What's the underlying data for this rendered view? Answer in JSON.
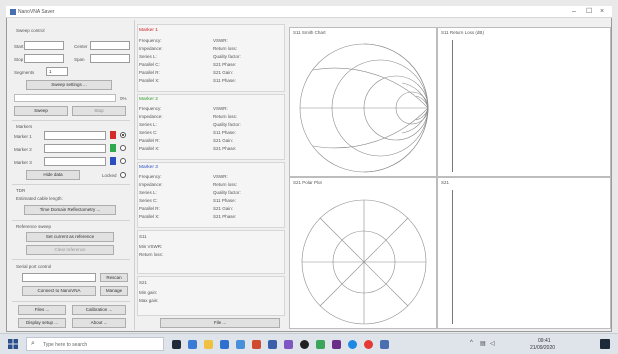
{
  "window": {
    "title": "NanoVNA Saver"
  },
  "sweep": {
    "header": "Sweep control",
    "start_label": "Start",
    "stop_label": "Stop",
    "center_label": "Center",
    "span_label": "Span",
    "segments_label": "Segments",
    "segments_value": "1",
    "settings_button": "Sweep settings ...",
    "progress_text": "0%",
    "sweep_button": "Sweep",
    "stop_button": "Stop"
  },
  "markers": {
    "header": "Markers",
    "items": [
      {
        "label": "Marker 1",
        "color": "#d42a2a"
      },
      {
        "label": "Marker 2",
        "color": "#2fa84f"
      },
      {
        "label": "Marker 3",
        "color": "#2b4fc0"
      }
    ],
    "hide_data_button": "Hide data",
    "locked_label": "Locked"
  },
  "tdr": {
    "header": "TDR",
    "cable_length_label": "Estimated cable length:",
    "tdr_button": "Time Domain Reflectometry ..."
  },
  "reference": {
    "header": "Reference sweep",
    "set_button": "Set current as reference",
    "clear_button": "Clear reference"
  },
  "serial": {
    "header": "Serial port control",
    "port_value": "",
    "rescan_button": "Rescan",
    "connect_button": "Connect to NanoVNA",
    "manage_button": "Manage"
  },
  "bottom": {
    "files_button": "Files ...",
    "calibration_button": "Calibration ...",
    "display_button": "Display setup ...",
    "about_button": "About ...",
    "file_button": "File ..."
  },
  "marker_panels": [
    {
      "title": "Marker 1",
      "left": [
        "Frequency:",
        "Impedance:",
        "Series L:",
        "Parallel C:",
        "Parallel R:",
        "Parallel X:"
      ],
      "right": [
        "VSWR:",
        "Return loss:",
        "Quality factor:",
        "S21 Phase:",
        "S21 Gain:",
        "S11 Phase:"
      ]
    },
    {
      "title": "Marker 2",
      "left": [
        "Frequency:",
        "Impedance:",
        "Series L:",
        "Series C:",
        "Parallel R:",
        "Parallel X:"
      ],
      "right": [
        "VSWR:",
        "Return loss:",
        "Quality factor:",
        "S11 Phase:",
        "S21 Gain:",
        "S21 Phase:"
      ]
    },
    {
      "title": "Marker 3",
      "left": [
        "Frequency:",
        "Impedance:",
        "Series L:",
        "Series C:",
        "Parallel R:",
        "Parallel X:"
      ],
      "right": [
        "VSWR:",
        "Return loss:",
        "Quality factor:",
        "S11 Phase:",
        "S21 Gain:",
        "S21 Phase:"
      ]
    }
  ],
  "s11_section": {
    "header": "S11",
    "lines": [
      "Min VSWR:",
      "Return loss:"
    ]
  },
  "s21_section": {
    "header": "S21",
    "lines": [
      "Min gain:",
      "Max gain:"
    ]
  },
  "plots": {
    "smith": "S11 Smith Chart",
    "return_loss": "S11 Return Loss (dB)",
    "polar": "S21 Polar Plot",
    "gain": "S21"
  },
  "taskbar": {
    "search_placeholder": "Type here to search",
    "time": "09:41",
    "date": "21/09/2020"
  },
  "colors": {
    "red": "#d42a2a",
    "green": "#2fa84f",
    "blue": "#2b4fc0"
  }
}
